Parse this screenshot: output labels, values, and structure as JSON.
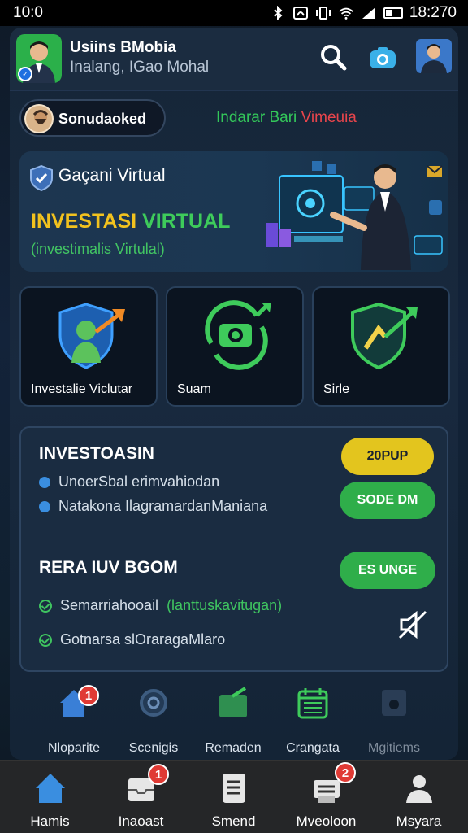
{
  "status_bar": {
    "time_left": "10:0",
    "time_right": "18:270"
  },
  "header": {
    "app_name": "Usiins BMobia",
    "subtitle": "Inalang, IGao Mohal"
  },
  "profile_pill": {
    "label": "Sonudaoked"
  },
  "promo": {
    "green_text": "Indarar Bari",
    "red_text": "Vimeuia"
  },
  "banner": {
    "title": "Gaçani Virtual",
    "headline_part1": "INVESTASI",
    "headline_part2": "VIRTUAL",
    "subtitle": "(investimalis Virtulal)"
  },
  "tiles": [
    {
      "label": "Investalie Viclutar"
    },
    {
      "label": "Suam"
    },
    {
      "label": "Sirle"
    }
  ],
  "info_card": {
    "section1_title": "INVESTOASIN",
    "section1_items": [
      "UnoerSbal erimvahiodan",
      "Natakona IlagramardanManiana"
    ],
    "btn_yellow": "20PUP",
    "btn_green1": "SODE DM",
    "section2_title": "RERA IUV BGOM",
    "btn_green2": "ES UNGE",
    "section2_item1_main": "Semarriahooail",
    "section2_item1_hl": "(lanttuskavitugan)",
    "section2_item2": "Gotnarsa slOraragaMlaro"
  },
  "shortcuts": [
    {
      "label": "Nloparite",
      "badge": "1"
    },
    {
      "label": "Scenigis"
    },
    {
      "label": "Remaden"
    },
    {
      "label": "Crangata"
    },
    {
      "label": "Mgitiems"
    }
  ],
  "bottom_nav": [
    {
      "label": "Hamis"
    },
    {
      "label": "Inaoast",
      "badge": "1"
    },
    {
      "label": "Smend"
    },
    {
      "label": "Mveoloon",
      "badge": "2"
    },
    {
      "label": "Msyara"
    }
  ],
  "colors": {
    "accent_green": "#33c75a",
    "accent_yellow": "#f2c21e",
    "alert_red": "#e03a34",
    "nav_blue": "#3a8ee0"
  }
}
